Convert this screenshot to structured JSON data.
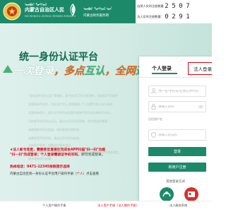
{
  "header": {
    "gov_name": "内蒙古自治区人民政府",
    "gov_name_mn": "ᠥᠪᠥᠷ ᠮᠣᠩᠭᠣᠯ",
    "platform_name": "内蒙古政务服务网",
    "platform_name_mn": "ᠥᠪᠥᠷ ᠮᠣᠩᠭᠣᠯ ᠤᠨ",
    "platform_en": "NEI MONGOL ZIZHIQU RENMIN ZHENGFU"
  },
  "stats": {
    "natural_label": "自然人实时注册数量：",
    "natural_digits": [
      "2",
      "5",
      "0",
      "7"
    ],
    "legal_label": "法人实时注册数量：",
    "legal_digits": [
      "0",
      "2",
      "9",
      "1"
    ]
  },
  "banner": {
    "title": "统一身份认证平台",
    "sub_part1": "一次",
    "sub_part2": "登录",
    "sub_part3": "，多点",
    "sub_part4": "互认",
    "sub_part5": "，全网",
    "sub_part6": "通行"
  },
  "notices": [
    "“身份证件实名认证”等服务，选手机号CTID卡等两种，依照如CTID提供",
    "全国所有手机号，可在用户中心-我的服务-个人设置中进行自行修改；",
    "全国所有用户，请点击手机号码设置并更改手机号码为新的手机号，",
    "可在新手机号码认证后，请点击手机号码更新，首次登录时需要；",
    "请使用新手机号登录，请勿更改注册信息，",
    "若需使用手机号码，请点击手机号码修改，",
    "全新用户登录，如需退出请先退出，",
    "请先点击退出后，再点击登录，勿同时多人登录，请知晓并遵守相关规定，",
    "联系客服进行处理，"
  ],
  "qr_notice": {
    "text": "★法人新号变更，需要移至直接在完成本APP扫描\"扫一扫\"功能",
    "text2": "\"扫一扫\"完成登录；个人登录需验证手机号码，",
    "normal": "即可完成登录。"
  },
  "hotline": "热线电话：0471-12345按照提示选择",
  "footnote": {
    "text": "内蒙古自治区统一身份认证平台用户操作手册（",
    "link": "个人",
    "text2": "）点击查看"
  },
  "login": {
    "tab_personal": "个人登录",
    "tab_legal": "法人登录",
    "username_placeholder": "用户名/手机号/社会信用代码",
    "password_placeholder": "请输入密码",
    "captcha_placeholder": "请输入验证码",
    "remember": "记住用户名",
    "forgot": "忘记密码",
    "login_button": "登录",
    "register_button": "新用户注册",
    "other_login": "其他登录方式",
    "quick1": "蒙速办扫一扫登录",
    "quick2": "电子社保卡扫码登录"
  },
  "bottom_nav": {
    "left": "个人用户操作手册",
    "mid": "法人用户手册（法人操作手册）",
    "right": "法人服务系统"
  }
}
